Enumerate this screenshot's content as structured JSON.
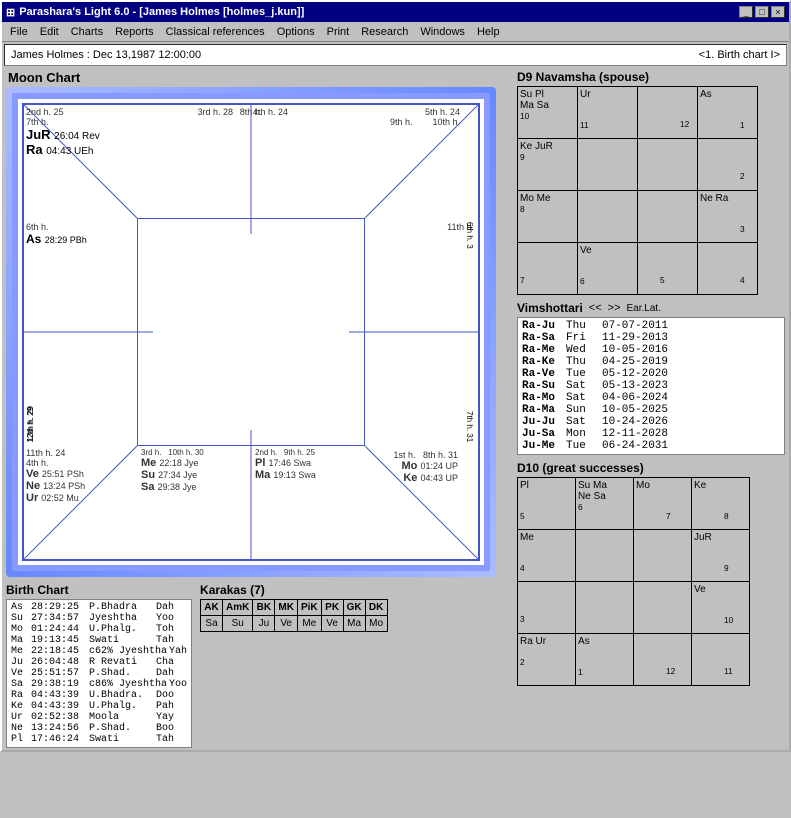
{
  "titleBar": {
    "title": "Parashara's Light 6.0 - [James Holmes  [holmes_j.kun]]",
    "buttons": [
      "_",
      "□",
      "×"
    ]
  },
  "menuBar": {
    "items": [
      "File",
      "Edit",
      "Charts",
      "Reports",
      "Classical references",
      "Options",
      "Print",
      "Research",
      "Windows",
      "Help"
    ]
  },
  "statusBar": {
    "left": "James Holmes :  Dec 13,1987  12:00:00",
    "right": "<1. Birth chart I>"
  },
  "moonChart": {
    "title": "Moon Chart",
    "cells": {
      "top_left": {
        "house": "2nd h. 25",
        "inner_house": "7th h.",
        "planets": [
          "JuR 26:04 Rev",
          "Ra 04:43 UEh"
        ]
      },
      "top_mid": {
        "house": "3rd h. 28",
        "inner_house": "8th h."
      },
      "top_right": {
        "house": "4th h. 24",
        "inner_house": "9th h."
      },
      "top_far_right": {
        "house": "5th h. 24",
        "inner_house": "10th h."
      },
      "left_top": {
        "house": "13th h. 29",
        "planets": [
          "As 28:29 PBh"
        ]
      },
      "left_mid": {
        "inner_house": "6th h."
      },
      "left_bot": {
        "house": "12th h. 29"
      },
      "right_top": {
        "house": "6th h. 3",
        "inner_house": "11th h."
      },
      "right_mid": {
        "house": "7th h. 31"
      },
      "bot_left": {
        "house": "4th h.",
        "planets": [
          "Ve 25:51 PSh",
          "Ne 13:24 PSh",
          "Ur 02:52 Mu"
        ],
        "inner_house": "11th h. 24"
      },
      "bot_mid_left": {
        "house": "3rd h.",
        "planets": [
          "Me 22:18 Jye",
          "Su 27:34 Jye",
          "Sa 29:38 Jye"
        ],
        "inner_house": "10th h. 30"
      },
      "bot_mid_right": {
        "house": "2nd h.",
        "planets": [
          "Pl 17:46 Swa",
          "Ma 19:13 Swa"
        ],
        "inner_house": "9th h. 25"
      },
      "bot_right": {
        "house": "1st h.",
        "planets": [
          "Mo 01:24 UP",
          "Ke 04:43 UP"
        ],
        "inner_house": "8th h. 31"
      }
    }
  },
  "d9Navamsha": {
    "title": "D9 Navamsha  (spouse)",
    "cells": [
      {
        "row": 0,
        "col": 0,
        "content": "Su Pl\nMa Sa\n10",
        "number": ""
      },
      {
        "row": 0,
        "col": 1,
        "content": "Ur\n11",
        "number": ""
      },
      {
        "row": 0,
        "col": 2,
        "content": "12",
        "number": ""
      },
      {
        "row": 0,
        "col": 3,
        "content": "As\n1",
        "number": ""
      },
      {
        "row": 1,
        "col": 0,
        "content": "Ke JuR\n9",
        "number": ""
      },
      {
        "row": 1,
        "col": 1,
        "content": "",
        "number": ""
      },
      {
        "row": 1,
        "col": 2,
        "content": "",
        "number": ""
      },
      {
        "row": 1,
        "col": 3,
        "content": "2",
        "number": ""
      },
      {
        "row": 2,
        "col": 0,
        "content": "Mo Me\n8",
        "number": ""
      },
      {
        "row": 2,
        "col": 1,
        "content": "",
        "number": ""
      },
      {
        "row": 2,
        "col": 2,
        "content": "",
        "number": ""
      },
      {
        "row": 2,
        "col": 3,
        "content": "Ne Ra\n3",
        "number": ""
      },
      {
        "row": 3,
        "col": 0,
        "content": "7",
        "number": ""
      },
      {
        "row": 3,
        "col": 1,
        "content": "Ve\n6",
        "number": ""
      },
      {
        "row": 3,
        "col": 2,
        "content": "5",
        "number": ""
      },
      {
        "row": 3,
        "col": 3,
        "content": "4",
        "number": ""
      }
    ]
  },
  "vimshottari": {
    "title": "Vimshottari",
    "nav_prev": "<<",
    "nav_next": ">>",
    "ear_lat": "Ear.Lat.",
    "rows": [
      {
        "period": "Ra-Ju",
        "day": "Thu",
        "date": "07-07-2011"
      },
      {
        "period": "Ra-Sa",
        "day": "Fri",
        "date": "11-29-2013"
      },
      {
        "period": "Ra-Me",
        "day": "Wed",
        "date": "10-05-2016"
      },
      {
        "period": "Ra-Ke",
        "day": "Thu",
        "date": "04-25-2019"
      },
      {
        "period": "Ra-Ve",
        "day": "Tue",
        "date": "05-12-2020"
      },
      {
        "period": "Ra-Su",
        "day": "Sat",
        "date": "05-13-2023"
      },
      {
        "period": "Ra-Mo",
        "day": "Sat",
        "date": "04-06-2024"
      },
      {
        "period": "Ra-Ma",
        "day": "Sun",
        "date": "10-05-2025"
      },
      {
        "period": "Ju-Ju",
        "day": "Sat",
        "date": "10-24-2026"
      },
      {
        "period": "Ju-Sa",
        "day": "Mon",
        "date": "12-11-2028"
      },
      {
        "period": "Ju-Me",
        "day": "Tue",
        "date": "06-24-2031"
      }
    ]
  },
  "birthChart": {
    "title": "Birth Chart",
    "rows": [
      {
        "planet": "As",
        "degree": "28:29:25",
        "nakshatra": "P.Bhadra",
        "rasi": "Dah"
      },
      {
        "planet": "Su",
        "degree": "27:34:57",
        "nakshatra": "Jyeshtha",
        "rasi": "Yoo"
      },
      {
        "planet": "Mo",
        "degree": "01:24:44",
        "nakshatra": "U.Phalg.",
        "rasi": "Toh"
      },
      {
        "planet": "Ma",
        "degree": "19:13:45",
        "nakshatra": "Swati",
        "rasi": "Tah"
      },
      {
        "planet": "Me",
        "degree": "22:18:45",
        "nakshatra": "c62%  Jyeshtha",
        "rasi": "Yah"
      },
      {
        "planet": "Ju",
        "degree": "26:04:48",
        "nakshatra": "R  Revati",
        "rasi": "Cha"
      },
      {
        "planet": "Ve",
        "degree": "25:51:57",
        "nakshatra": "P.Shad.",
        "rasi": "Dah"
      },
      {
        "planet": "Sa",
        "degree": "29:38:19",
        "nakshatra": "c86%  Jyeshtha",
        "rasi": "Yoo"
      },
      {
        "planet": "Ra",
        "degree": "04:43:39",
        "nakshatra": "U.Bhadra.",
        "rasi": "Doo"
      },
      {
        "planet": "Ke",
        "degree": "04:43:39",
        "nakshatra": "U.Phalg.",
        "rasi": "Pah"
      },
      {
        "planet": "Ur",
        "degree": "02:52:38",
        "nakshatra": "Moola",
        "rasi": "Yay"
      },
      {
        "planet": "Ne",
        "degree": "13:24:56",
        "nakshatra": "P.Shad.",
        "rasi": "Boo"
      },
      {
        "planet": "Pl",
        "degree": "17:46:24",
        "nakshatra": "Swati",
        "rasi": "Tah"
      }
    ]
  },
  "karakas": {
    "title": "Karakas (7)",
    "headers": [
      "AK",
      "AmK",
      "BK",
      "MK",
      "PiK",
      "PK",
      "GK",
      "DK"
    ],
    "values": [
      "Sa",
      "Su",
      "Ju",
      "Ve",
      "Me",
      "Ve",
      "Ma",
      "Mo"
    ]
  },
  "d10": {
    "title": "D10  (great successes)",
    "cells": [
      {
        "row": 0,
        "col": 0,
        "content": "Pl\n5"
      },
      {
        "row": 0,
        "col": 1,
        "content": "Su Ma\nNe Sa\n6"
      },
      {
        "row": 0,
        "col": 2,
        "content": "Mo\n7"
      },
      {
        "row": 0,
        "col": 3,
        "content": "Ke\n8"
      },
      {
        "row": 1,
        "col": 0,
        "content": "Me\n4"
      },
      {
        "row": 1,
        "col": 1,
        "content": ""
      },
      {
        "row": 1,
        "col": 2,
        "content": ""
      },
      {
        "row": 1,
        "col": 3,
        "content": "JuR\n9"
      },
      {
        "row": 2,
        "col": 0,
        "content": "3"
      },
      {
        "row": 2,
        "col": 1,
        "content": ""
      },
      {
        "row": 2,
        "col": 2,
        "content": ""
      },
      {
        "row": 2,
        "col": 3,
        "content": "Ve\n10"
      },
      {
        "row": 3,
        "col": 0,
        "content": "Ra Ur\n2"
      },
      {
        "row": 3,
        "col": 1,
        "content": "As\n1"
      },
      {
        "row": 3,
        "col": 2,
        "content": "12"
      },
      {
        "row": 3,
        "col": 3,
        "content": "11"
      }
    ]
  }
}
